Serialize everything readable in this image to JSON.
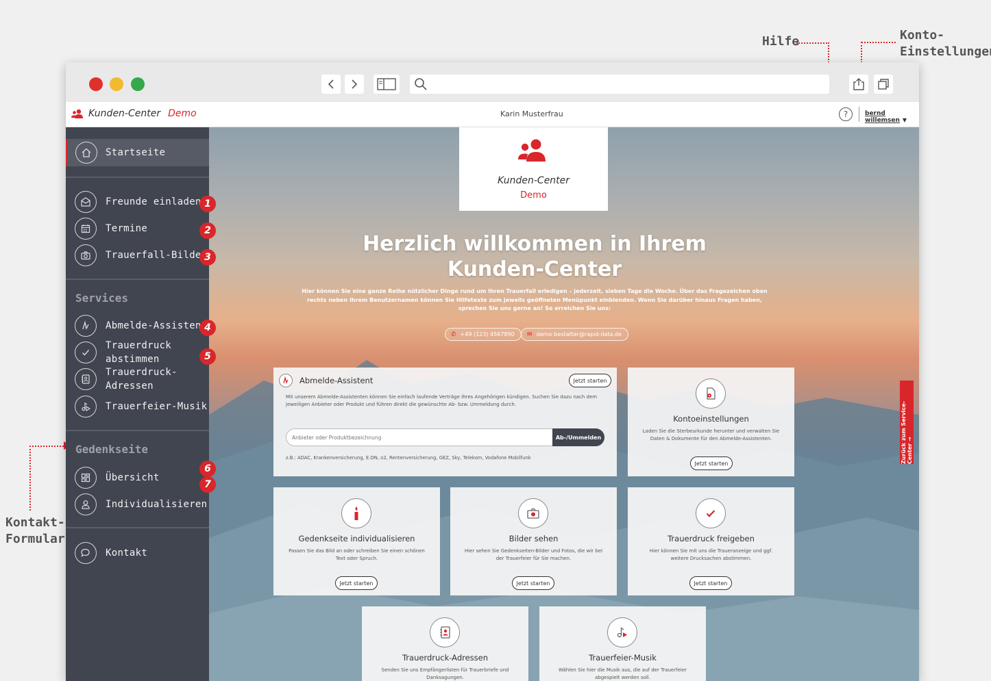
{
  "annotations": {
    "help": "Hilfe",
    "account_line1": "Konto-",
    "account_line2": "Einstellungen",
    "contact_line1": "Kontakt-",
    "contact_line2": "Formular"
  },
  "colors": {
    "accent": "#d9262b",
    "sidebar": "#414550",
    "sidebar_active": "#575b66"
  },
  "browser": {
    "traffic_lights": [
      "#e0302c",
      "#f2bb2d",
      "#35a849"
    ],
    "icons": [
      "back-icon",
      "forward-icon",
      "sidebar-toggle-icon",
      "search-icon",
      "share-icon",
      "tabs-icon"
    ]
  },
  "appbar": {
    "brand": "Kunden-Center",
    "brand_demo": "Demo",
    "user_name": "Karin Musterfrau",
    "help_icon": "?",
    "account": "bernd willemsen"
  },
  "sidebar": {
    "home": "Startseite",
    "items_top": [
      {
        "label": "Freunde einladen",
        "badge": "1",
        "icon": "envelope-icon"
      },
      {
        "label": "Termine",
        "badge": "2",
        "icon": "calendar-icon"
      },
      {
        "label": "Trauerfall-Bilder",
        "badge": "3",
        "icon": "camera-icon"
      }
    ],
    "services_heading": "Services",
    "services": [
      {
        "label": "Abmelde-Assistent",
        "badge": "4",
        "icon": "signature-icon"
      },
      {
        "label_line1": "Trauerdruck",
        "label_line2": "abstimmen",
        "badge": "5",
        "icon": "check-icon"
      },
      {
        "label_line1": "Trauerdruck-",
        "label_line2": "Adressen",
        "icon": "address-book-icon"
      },
      {
        "label": "Trauerfeier-Musik",
        "badge": "6",
        "icon": "music-icon"
      }
    ],
    "memorial_heading": "Gedenkseite",
    "memorial": [
      {
        "label": "Übersicht",
        "badge": "7",
        "icon": "grid-icon"
      },
      {
        "label": "Individualisieren",
        "icon": "user-icon"
      }
    ],
    "contact": "Kontakt"
  },
  "main": {
    "logo_title": "Kunden-Center",
    "logo_demo": "Demo",
    "welcome_title": "Herzlich willkommen in Ihrem Kunden-Center",
    "welcome_text": "Hier können Sie eine ganze Reihe nützlicher Dinge rund um Ihren Trauerfall erledigen – jederzeit, sieben Tage die Woche. Über das Fragezeichen oben rechts neben Ihrem Benutzernamen können Sie Hilfetexte zum jeweils geöffneten Menüpunkt einblenden. Wenn Sie darüber hinaus Fragen haben, sprechen Sie uns gerne an! So erreichen Sie uns:",
    "phone": "+49 (123) 4567890",
    "email": "demo-bestatter@rapid-data.de",
    "side_tab": "Zurück zum Service-Center →"
  },
  "cards": {
    "abmelde": {
      "title": "Abmelde-Assistent",
      "button": "Jetzt starten",
      "desc": "Mit unserem Abmelde-Assistenten können Sie einfach laufende Verträge Ihres Angehörigen kündigen. Suchen Sie dazu nach dem jeweiligen Anbieter oder Produkt und führen direkt die gewünschte Ab- bzw. Ummeldung durch.",
      "search_placeholder": "Anbieter oder Produktbezeichnung",
      "search_button": "Ab-/Ummelden",
      "examples": "z.B.: ADAC, Krankenversicherung, E.ON, o2, Rentenversicherung, GEZ, Sky, Telekom, Vodafone Mobilfunk"
    },
    "konto": {
      "title": "Kontoeinstellungen",
      "desc": "Laden Sie die Sterbeurkunde herunter und verwalten Sie Daten & Dokumente für den Abmelde-Assistenten.",
      "button": "Jetzt starten"
    },
    "gedenkseite": {
      "title": "Gedenkseite individualisieren",
      "desc": "Passen Sie das Bild an oder schreiben Sie einen schönen Text oder Spruch.",
      "button": "Jetzt starten"
    },
    "bilder": {
      "title": "Bilder sehen",
      "desc": "Hier sehen Sie Gedenkseiten-Bilder und Fotos, die wir bei der Trauerfeier für Sie machen.",
      "button": "Jetzt starten"
    },
    "trauerdruck": {
      "title": "Trauerdruck freigeben",
      "desc": "Hier können Sie mit uns die Traueranzeige und ggf. weitere Drucksachen abstimmen.",
      "button": "Jetzt starten"
    },
    "adressen": {
      "title": "Trauerdruck-Adressen",
      "desc": "Senden Sie uns Empfängerlisten für Trauerbriefe und Danksagungen."
    },
    "musik": {
      "title": "Trauerfeier-Musik",
      "desc": "Wählen Sie hier die Musik aus, die auf der Trauerfeier abgespielt werden soll."
    }
  }
}
